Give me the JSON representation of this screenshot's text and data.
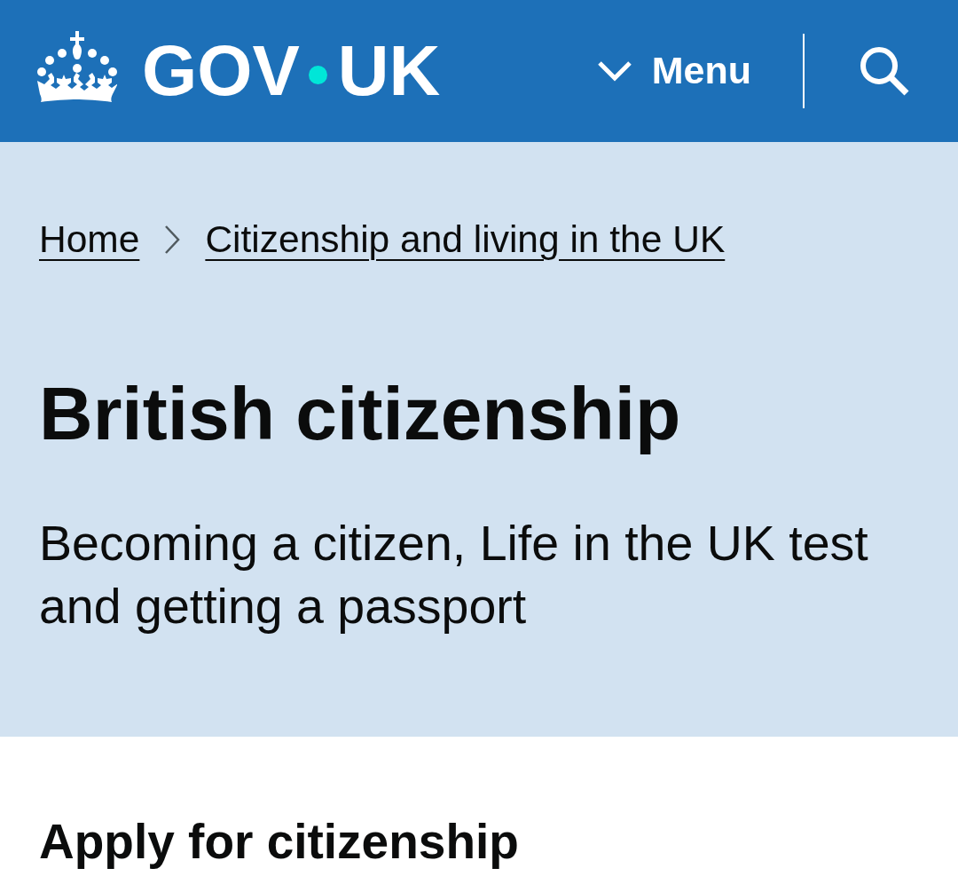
{
  "header": {
    "logo": {
      "left": "GOV",
      "right": "UK"
    },
    "menu_button": {
      "label": "Menu",
      "expanded": false
    }
  },
  "breadcrumbs": [
    {
      "label": "Home"
    },
    {
      "label": "Citizenship and living in the UK"
    }
  ],
  "hero": {
    "title": "British citizenship",
    "description": "Becoming a citizen, Life in the UK test and getting a passport"
  },
  "sections": [
    {
      "heading": "Apply for citizenship"
    }
  ]
}
